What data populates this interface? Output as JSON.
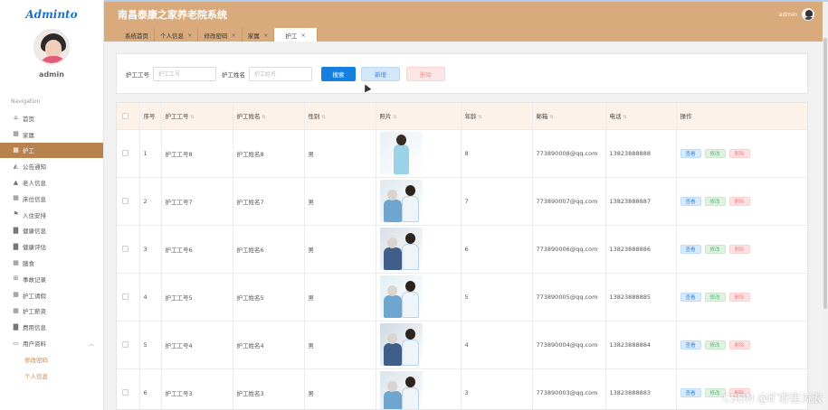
{
  "logo": "Adminto",
  "user": {
    "name": "admin"
  },
  "nav": {
    "title": "Navigation",
    "items": [
      {
        "label": "首页",
        "icon": "home-icon",
        "glyph": "⌂"
      },
      {
        "label": "家属",
        "icon": "grid-icon",
        "glyph": "▦"
      },
      {
        "label": "护工",
        "icon": "grid-icon",
        "glyph": "▦",
        "active": true
      },
      {
        "label": "公告通知",
        "icon": "megaphone-icon",
        "glyph": "◭"
      },
      {
        "label": "老人信息",
        "icon": "person-icon",
        "glyph": "▲"
      },
      {
        "label": "床位信息",
        "icon": "grid-icon",
        "glyph": "▦"
      },
      {
        "label": "入住安排",
        "icon": "flag-icon",
        "glyph": "⚑"
      },
      {
        "label": "健康信息",
        "icon": "box-icon",
        "glyph": "▇"
      },
      {
        "label": "健康评估",
        "icon": "box-icon",
        "glyph": "▇"
      },
      {
        "label": "膳食",
        "icon": "grid-icon",
        "glyph": "▦"
      },
      {
        "label": "事故记录",
        "icon": "table-icon",
        "glyph": "⊞"
      },
      {
        "label": "护工请假",
        "icon": "grid-icon",
        "glyph": "▦"
      },
      {
        "label": "护工薪资",
        "icon": "grid-icon",
        "glyph": "▦"
      },
      {
        "label": "费用信息",
        "icon": "box-icon",
        "glyph": "▇"
      },
      {
        "label": "用户资料",
        "icon": "user-card-icon",
        "glyph": "▭",
        "expandable": true
      }
    ],
    "sub_items": [
      "修改密码",
      "个人信息"
    ]
  },
  "header": {
    "title": "南昌泰康之家养老院系统",
    "user": "admin"
  },
  "tabs": [
    {
      "label": "系统首页",
      "closable": false
    },
    {
      "label": "个人信息",
      "closable": true
    },
    {
      "label": "修改密码",
      "closable": true
    },
    {
      "label": "家属",
      "closable": true
    },
    {
      "label": "护工",
      "closable": true,
      "active": true
    }
  ],
  "search": {
    "field1_label": "护工工号",
    "field1_placeholder": "护工工号",
    "field2_label": "护工姓名",
    "field2_placeholder": "护工姓名",
    "search_btn": "搜索",
    "add_btn": "新增",
    "delete_btn": "删除"
  },
  "table": {
    "columns": [
      "序号",
      "护工工号",
      "护工姓名",
      "性别",
      "照片",
      "年龄",
      "邮箱",
      "电话",
      "操作"
    ],
    "rows": [
      {
        "index": "1",
        "id": "护工工号8",
        "name": "护工姓名8",
        "gender": "男",
        "age": "8",
        "email": "773890008@qq.com",
        "phone": "13823888888",
        "photo": "nurse-standing"
      },
      {
        "index": "2",
        "id": "护工工号7",
        "name": "护工姓名7",
        "gender": "男",
        "age": "7",
        "email": "773890007@qq.com",
        "phone": "13823888887",
        "photo": "nurse-with-elder"
      },
      {
        "index": "3",
        "id": "护工工号6",
        "name": "护工姓名6",
        "gender": "男",
        "age": "6",
        "email": "773890006@qq.com",
        "phone": "13823888886",
        "photo": "nurse-with-elder"
      },
      {
        "index": "4",
        "id": "护工工号5",
        "name": "护工姓名5",
        "gender": "男",
        "age": "5",
        "email": "773890005@qq.com",
        "phone": "13823888885",
        "photo": "nurse-with-elder"
      },
      {
        "index": "5",
        "id": "护工工号4",
        "name": "护工姓名4",
        "gender": "男",
        "age": "4",
        "email": "773890004@qq.com",
        "phone": "13823888884",
        "photo": "nurse-with-elder"
      },
      {
        "index": "6",
        "id": "护工工号3",
        "name": "护工姓名3",
        "gender": "男",
        "age": "3",
        "email": "773890003@qq.com",
        "phone": "13823888883",
        "photo": "nurse-with-elder"
      }
    ],
    "actions": {
      "view": "查看",
      "edit": "修改",
      "delete": "删除"
    }
  },
  "watermark": "CSDN @旷野里流浪",
  "colors": {
    "header_bg": "#d9aa7c",
    "active_nav": "#b8824f",
    "primary": "#1680e0"
  }
}
